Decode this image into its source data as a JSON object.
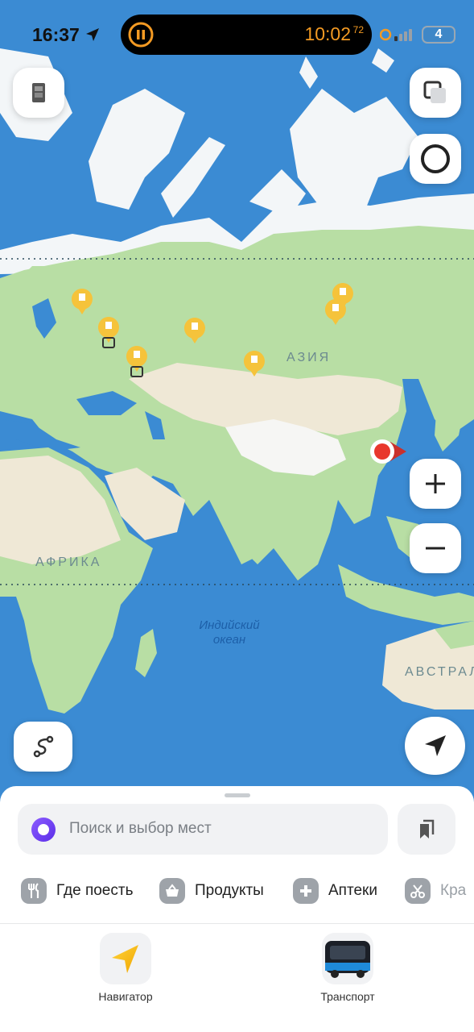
{
  "status_bar": {
    "time": "16:37",
    "timer": "10:02",
    "timer_fraction": "72",
    "battery": "4",
    "icons": [
      "location-arrow-icon",
      "pause-icon",
      "signal-icon",
      "battery-icon"
    ]
  },
  "map": {
    "region_labels": {
      "asia": "АЗИЯ",
      "africa": "АФРИКА",
      "australia": "АВСТРАЛ"
    },
    "ocean_label_line1": "Индийский",
    "ocean_label_line2": "океан",
    "colors": {
      "ocean": "#3d8fd6",
      "land_green": "#b7dea3",
      "land_desert": "#efe8d6",
      "ice": "#ffffff",
      "pin": "#f5c33b",
      "location": "#e8372c"
    },
    "controls": [
      "layers-button",
      "compass-button",
      "zoom-in-button",
      "zoom-out-button",
      "route-button",
      "my-location-button"
    ]
  },
  "sheet": {
    "search_placeholder": "Поиск и выбор мест",
    "categories": [
      {
        "label": "Где поесть",
        "icon": "fork-knife-icon"
      },
      {
        "label": "Продукты",
        "icon": "basket-icon"
      },
      {
        "label": "Аптеки",
        "icon": "pharmacy-cross-icon"
      },
      {
        "label": "Кра",
        "icon": "scissors-icon"
      }
    ],
    "tabs": [
      {
        "label": "Навигатор",
        "icon": "navigator-arrow-icon"
      },
      {
        "label": "Транспорт",
        "icon": "bus-icon"
      }
    ]
  }
}
